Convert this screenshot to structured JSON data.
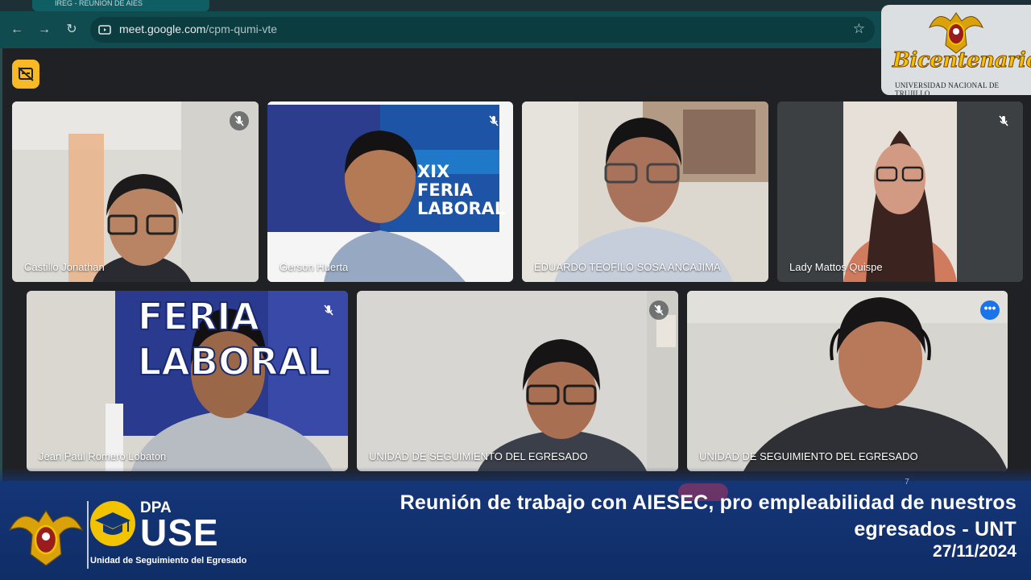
{
  "browser": {
    "tab_title": "IREG - REUNIÓN DE AIES",
    "url_host": "meet.google.com",
    "url_path": "/cpm-qumi-vte"
  },
  "branding": {
    "top_logo_title": "Bicentenario",
    "top_logo_subtitle": "UNIVERSIDAD NACIONAL DE TRUJILLO",
    "dpa_label": "DPA",
    "use_label": "USE",
    "use_subtitle": "Unidad de Seguimiento del Egresado"
  },
  "participants": [
    {
      "name": "Castillo Jonathan",
      "muted": true
    },
    {
      "name": "Gerson Huerta",
      "muted": true,
      "background_text": [
        "XIX",
        "FERIA",
        "LABORAL"
      ]
    },
    {
      "name": "EDUARDO TEOFILO SOSA ANCAJIMA",
      "muted": false
    },
    {
      "name": "Lady Mattos Quispe",
      "muted": true
    },
    {
      "name": "Jean Paul Romero Lobaton",
      "muted": true,
      "background_text": [
        "FERIA",
        "LABORAL"
      ]
    },
    {
      "name": "UNIDAD DE SEGUIMIENTO DEL EGRESADO",
      "muted": true
    },
    {
      "name": "UNIDAD DE SEGUIMIENTO DEL EGRESADO",
      "muted": false,
      "speaking": true
    }
  ],
  "caption": {
    "title": "Reunión de trabajo con AIESEC, pro empleabilidad de nuestros egresados - UNT",
    "date": "27/11/2024"
  },
  "meeting_controls": {
    "participant_count": "7"
  },
  "colors": {
    "browser_toolbar": "#0f4b4f",
    "meet_background": "#202124",
    "banner_blue": "#123573",
    "accent_yellow": "#f2c300",
    "speaking_outline": "#6fa4ee",
    "captions_button": "#f9b925"
  }
}
